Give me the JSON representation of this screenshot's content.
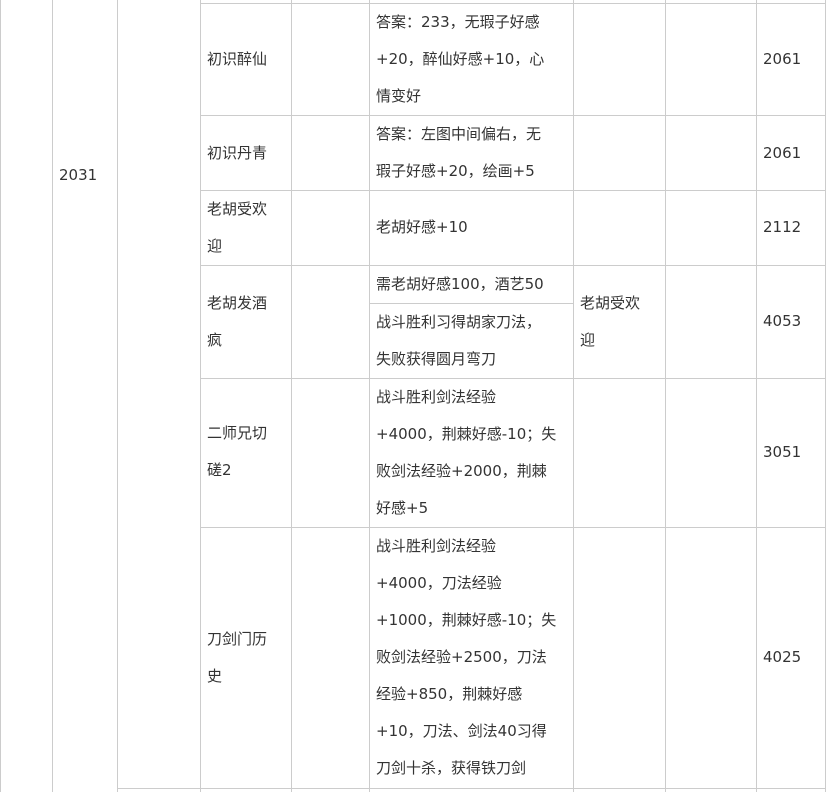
{
  "table": {
    "year_cell": "2031",
    "rows": [
      {
        "event_lines": [
          "初识醉仙"
        ],
        "effect_lines": [
          "答案：233，无瑕子好感",
          "+20，醉仙好感+10，心",
          "情变好"
        ],
        "next_event_lines": [],
        "id": "2061"
      },
      {
        "event_lines": [
          "初识丹青"
        ],
        "effect_lines": [
          "答案：左图中间偏右，无",
          "瑕子好感+20，绘画+5"
        ],
        "next_event_lines": [],
        "id": "2061"
      },
      {
        "event_lines": [
          "老胡受欢",
          "迎"
        ],
        "effect_lines": [
          "老胡好感+10"
        ],
        "next_event_lines": [],
        "id": "2112"
      },
      {
        "event_lines": [
          "老胡发酒",
          "疯"
        ],
        "requirement_lines": [
          "需老胡好感100，酒艺50"
        ],
        "effect_lines": [
          "战斗胜利习得胡家刀法，",
          "失败获得圆月弯刀"
        ],
        "next_event_lines": [
          "老胡受欢",
          "迎"
        ],
        "id": "4053"
      },
      {
        "event_lines": [
          "二师兄切",
          "磋2"
        ],
        "effect_lines": [
          "战斗胜利剑法经验",
          "+4000，荆棘好感-10；失",
          "败剑法经验+2000，荆棘",
          "好感+5"
        ],
        "next_event_lines": [],
        "id": "3051"
      },
      {
        "event_lines": [
          "刀剑门历",
          "史"
        ],
        "effect_lines": [
          "战斗胜利剑法经验",
          "+4000，刀法经验",
          "+1000，荆棘好感-10；失",
          "败剑法经验+2500，刀法",
          "经验+850，荆棘好感",
          "+10，刀法、剑法40习得",
          "刀剑十杀，获得铁刀剑"
        ],
        "next_event_lines": [],
        "id": "4025"
      }
    ]
  }
}
